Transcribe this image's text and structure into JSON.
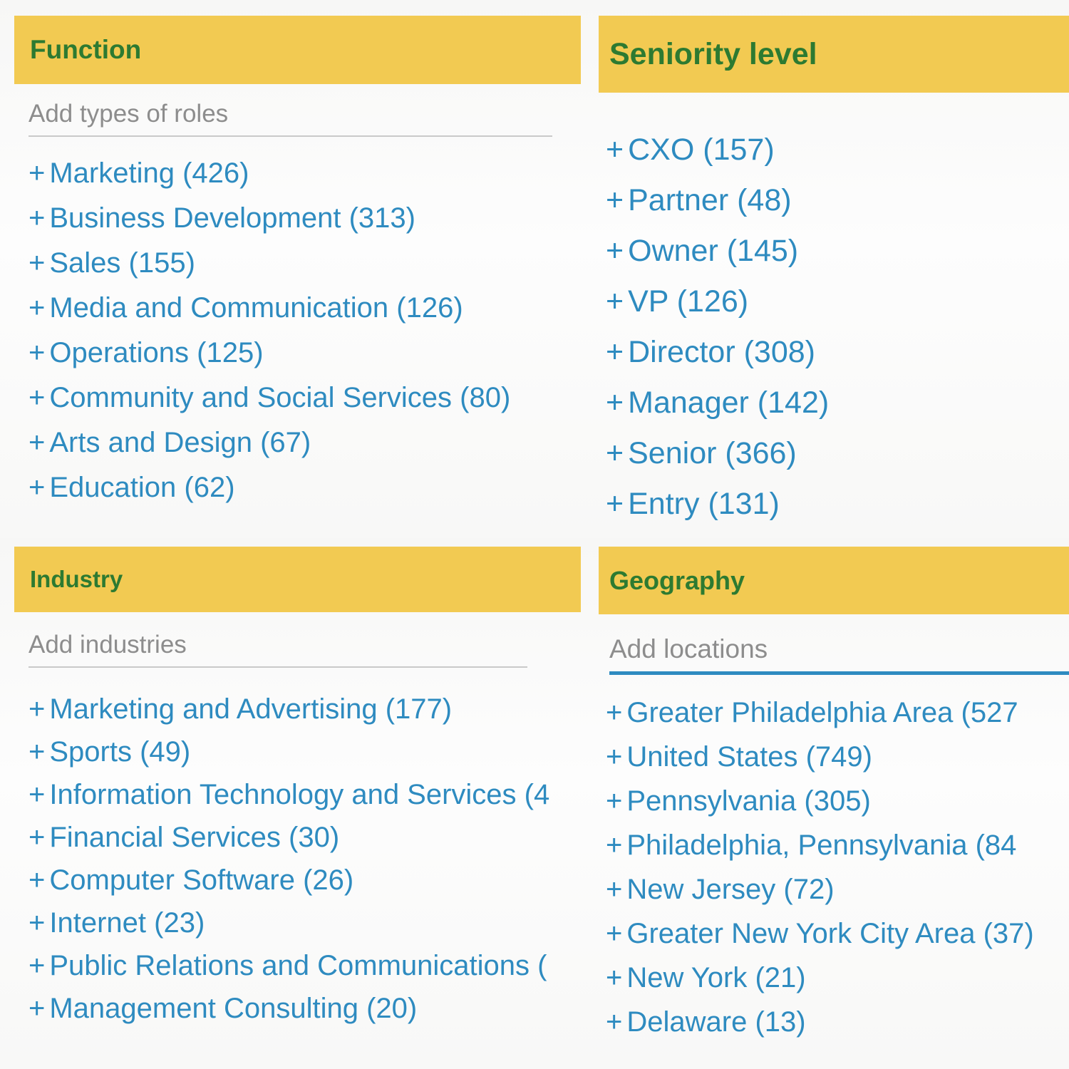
{
  "theme": {
    "header_bg": "#f2ca52",
    "header_text": "#2d7a31",
    "link_color": "#2e8bc0",
    "placeholder_color": "#8d8d8d",
    "page_bg": "#fbfbfa",
    "underline_gray": "#c9c9c9",
    "underline_focus": "#2e8bc0"
  },
  "panels": {
    "function": {
      "title": "Function",
      "placeholder": "Add types of roles",
      "input_value": "",
      "input_focused": false,
      "options": [
        {
          "prefix": "+",
          "label": "Marketing",
          "count": "(426)"
        },
        {
          "prefix": "+",
          "label": "Business Development",
          "count": "(313)"
        },
        {
          "prefix": "+",
          "label": "Sales",
          "count": "(155)"
        },
        {
          "prefix": "+",
          "label": "Media and Communication",
          "count": "(126)"
        },
        {
          "prefix": "+",
          "label": "Operations",
          "count": "(125)"
        },
        {
          "prefix": "+",
          "label": "Community and Social Services",
          "count": "(80)"
        },
        {
          "prefix": "+",
          "label": "Arts and Design",
          "count": "(67)"
        },
        {
          "prefix": "+",
          "label": "Education",
          "count": "(62)"
        }
      ]
    },
    "seniority": {
      "title": "Seniority level",
      "placeholder": "",
      "input_value": "",
      "input_focused": false,
      "options": [
        {
          "prefix": "+",
          "label": "CXO",
          "count": "(157)"
        },
        {
          "prefix": "+",
          "label": "Partner",
          "count": "(48)"
        },
        {
          "prefix": "+",
          "label": "Owner",
          "count": "(145)"
        },
        {
          "prefix": "+",
          "label": "VP",
          "count": "(126)"
        },
        {
          "prefix": "+",
          "label": "Director",
          "count": "(308)"
        },
        {
          "prefix": "+",
          "label": "Manager",
          "count": "(142)"
        },
        {
          "prefix": "+",
          "label": "Senior",
          "count": "(366)"
        },
        {
          "prefix": "+",
          "label": "Entry",
          "count": "(131)"
        }
      ]
    },
    "industry": {
      "title": "Industry",
      "placeholder": "Add industries",
      "input_value": "",
      "input_focused": false,
      "options": [
        {
          "prefix": "+",
          "label": "Marketing and Advertising",
          "count": "(177)"
        },
        {
          "prefix": "+",
          "label": "Sports",
          "count": "(49)"
        },
        {
          "prefix": "+",
          "label": "Information Technology and Services",
          "count": "(4"
        },
        {
          "prefix": "+",
          "label": "Financial Services",
          "count": "(30)"
        },
        {
          "prefix": "+",
          "label": "Computer Software",
          "count": "(26)"
        },
        {
          "prefix": "+",
          "label": "Internet",
          "count": "(23)"
        },
        {
          "prefix": "+",
          "label": "Public Relations and Communications",
          "count": "("
        },
        {
          "prefix": "+",
          "label": "Management Consulting",
          "count": "(20)"
        }
      ]
    },
    "geography": {
      "title": "Geography",
      "placeholder": "Add locations",
      "input_value": "",
      "input_focused": true,
      "options": [
        {
          "prefix": "+",
          "label": "Greater Philadelphia Area",
          "count": "(527"
        },
        {
          "prefix": "+",
          "label": "United States",
          "count": "(749)"
        },
        {
          "prefix": "+",
          "label": "Pennsylvania",
          "count": "(305)"
        },
        {
          "prefix": "+",
          "label": "Philadelphia, Pennsylvania",
          "count": "(84"
        },
        {
          "prefix": "+",
          "label": "New Jersey",
          "count": "(72)"
        },
        {
          "prefix": "+",
          "label": "Greater New York City Area",
          "count": "(37)"
        },
        {
          "prefix": "+",
          "label": "New York",
          "count": "(21)"
        },
        {
          "prefix": "+",
          "label": "Delaware",
          "count": "(13)"
        }
      ]
    }
  }
}
